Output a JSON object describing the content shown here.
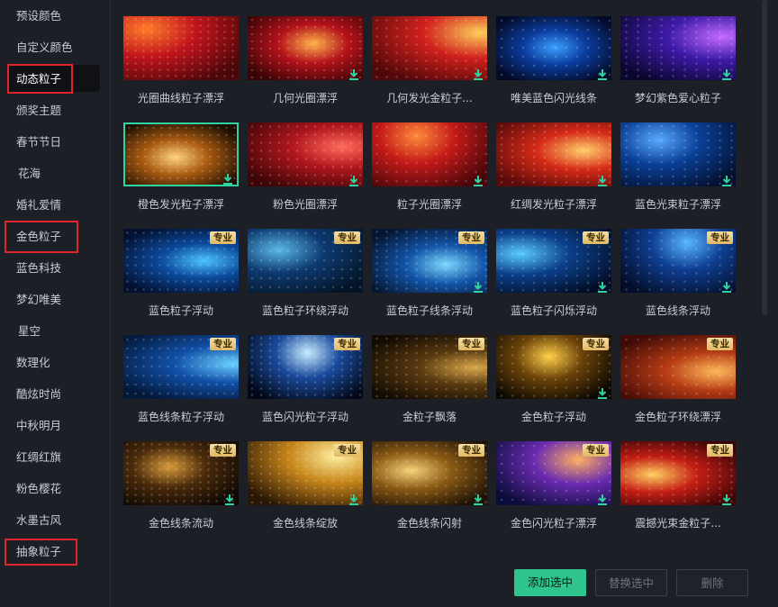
{
  "sidebar": {
    "items": [
      {
        "label": "预设颜色"
      },
      {
        "label": "自定义颜色"
      },
      {
        "label": "动态粒子"
      },
      {
        "label": "颁奖主题"
      },
      {
        "label": "春节节日"
      },
      {
        "label": "花海"
      },
      {
        "label": "婚礼爱情"
      },
      {
        "label": "金色粒子"
      },
      {
        "label": "蓝色科技"
      },
      {
        "label": "梦幻唯美"
      },
      {
        "label": "星空"
      },
      {
        "label": "数理化"
      },
      {
        "label": "酷炫时尚"
      },
      {
        "label": "中秋明月"
      },
      {
        "label": "红绸红旗"
      },
      {
        "label": "粉色樱花"
      },
      {
        "label": "水墨古风"
      },
      {
        "label": "抽象粒子"
      }
    ],
    "active_index": 2
  },
  "badge_label": "专业",
  "grid": [
    {
      "title": "光圈曲线粒子漂浮",
      "badge": false,
      "download": false,
      "selected": false,
      "c1": "#ff7b2a",
      "c2": "#c2141b",
      "c3": "#4a0608"
    },
    {
      "title": "几何光圈漂浮",
      "badge": false,
      "download": true,
      "selected": false,
      "c1": "#ffb24a",
      "c2": "#b4121a",
      "c3": "#3a0406"
    },
    {
      "title": "几何发光金粒子...",
      "badge": false,
      "download": true,
      "selected": false,
      "c1": "#ffcf5a",
      "c2": "#d0201c",
      "c3": "#520709"
    },
    {
      "title": "唯美蓝色闪光线条",
      "badge": false,
      "download": true,
      "selected": false,
      "c1": "#3aa0ff",
      "c2": "#0b3c9e",
      "c3": "#020a26"
    },
    {
      "title": "梦幻紫色爱心粒子",
      "badge": false,
      "download": true,
      "selected": false,
      "c1": "#c46bff",
      "c2": "#3d1aa8",
      "c3": "#0b0630"
    },
    {
      "title": "橙色发光粒子漂浮",
      "badge": false,
      "download": true,
      "selected": true,
      "c1": "#ffd27a",
      "c2": "#a85a10",
      "c3": "#1a0d02"
    },
    {
      "title": "粉色光圈漂浮",
      "badge": false,
      "download": true,
      "selected": false,
      "c1": "#ff6a5a",
      "c2": "#b0161c",
      "c3": "#3e0508"
    },
    {
      "title": "粒子光圈漂浮",
      "badge": false,
      "download": true,
      "selected": false,
      "c1": "#ff8a3a",
      "c2": "#c41a18",
      "c3": "#48060a"
    },
    {
      "title": "红绸发光粒子漂浮",
      "badge": false,
      "download": true,
      "selected": false,
      "c1": "#ffcf6a",
      "c2": "#d62a18",
      "c3": "#5a0a08"
    },
    {
      "title": "蓝色光束粒子漂浮",
      "badge": false,
      "download": true,
      "selected": false,
      "c1": "#58a8ff",
      "c2": "#0a3f96",
      "c3": "#03102e"
    },
    {
      "title": "蓝色粒子浮动",
      "badge": true,
      "download": false,
      "selected": false,
      "c1": "#4cc4ff",
      "c2": "#0b4a9c",
      "c3": "#031030"
    },
    {
      "title": "蓝色粒子环绕浮动",
      "badge": true,
      "download": false,
      "selected": false,
      "c1": "#5ab8e8",
      "c2": "#0d3a70",
      "c3": "#041426"
    },
    {
      "title": "蓝色粒子线条浮动",
      "badge": true,
      "download": true,
      "selected": false,
      "c1": "#7ad8ff",
      "c2": "#1254a8",
      "c3": "#041632"
    },
    {
      "title": "蓝色粒子闪烁浮动",
      "badge": true,
      "download": true,
      "selected": false,
      "c1": "#5acbff",
      "c2": "#0b3f8a",
      "c3": "#020c24"
    },
    {
      "title": "蓝色线条浮动",
      "badge": true,
      "download": true,
      "selected": false,
      "c1": "#58b6ff",
      "c2": "#0e3e92",
      "c3": "#030e2a"
    },
    {
      "title": "蓝色线条粒子浮动",
      "badge": true,
      "download": false,
      "selected": false,
      "c1": "#6ad0ff",
      "c2": "#1150a8",
      "c3": "#04183a"
    },
    {
      "title": "蓝色闪光粒子浮动",
      "badge": true,
      "download": false,
      "selected": false,
      "c1": "#c8ecff",
      "c2": "#1a4a9c",
      "c3": "#020818"
    },
    {
      "title": "金粒子飘落",
      "badge": true,
      "download": false,
      "selected": false,
      "c1": "#d9a84a",
      "c2": "#5a3a10",
      "c3": "#140c02"
    },
    {
      "title": "金色粒子浮动",
      "badge": true,
      "download": true,
      "selected": false,
      "c1": "#ffcf4a",
      "c2": "#6a4208",
      "c3": "#0a0602"
    },
    {
      "title": "金色粒子环绕漂浮",
      "badge": true,
      "download": false,
      "selected": false,
      "c1": "#ffb85a",
      "c2": "#b43a14",
      "c3": "#400a06"
    },
    {
      "title": "金色线条流动",
      "badge": true,
      "download": true,
      "selected": false,
      "c1": "#d89a3a",
      "c2": "#4a2a0a",
      "c3": "#0e0804"
    },
    {
      "title": "金色线条绽放",
      "badge": true,
      "download": true,
      "selected": false,
      "c1": "#fff0a0",
      "c2": "#c8861a",
      "c3": "#2a1604"
    },
    {
      "title": "金色线条闪射",
      "badge": true,
      "download": true,
      "selected": false,
      "c1": "#f6d27a",
      "c2": "#8a5a14",
      "c3": "#1e1206"
    },
    {
      "title": "金色闪光粒子漂浮",
      "badge": true,
      "download": true,
      "selected": false,
      "c1": "#ffb060",
      "c2": "#6a2ab0",
      "c3": "#0a0c3a"
    },
    {
      "title": "震撼光束金粒子...",
      "badge": true,
      "download": true,
      "selected": false,
      "c1": "#ffd060",
      "c2": "#c41e14",
      "c3": "#3a0406"
    }
  ],
  "buttons": {
    "add": "添加选中",
    "replace": "替换选中",
    "delete": "删除"
  },
  "colors": {
    "accent": "#2fc48d",
    "highlight_box": "#e0242c",
    "badge": "#e2b964"
  }
}
